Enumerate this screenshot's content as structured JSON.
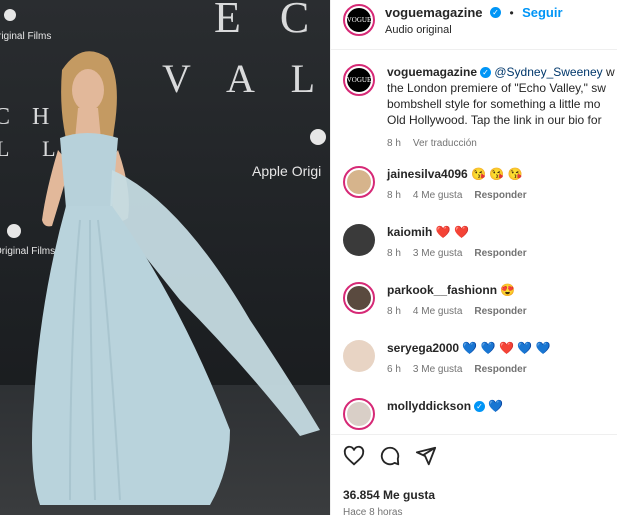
{
  "photo": {
    "bg_text_1": "E C",
    "bg_text_2": "V A L",
    "bg_text_3": "C H O",
    "bg_text_4": "L L",
    "original_films_1": "riginal Films",
    "original_films_2": "Original Films",
    "apple_original": "Apple Origi"
  },
  "header": {
    "avatar_text": "VOGUE",
    "username": "voguemagazine",
    "follow_label": "Seguir",
    "audio": "Audio original"
  },
  "caption": {
    "username": "voguemagazine",
    "mention": "@Sydney_Sweeney",
    "line1_rest": " w",
    "line2": "the London premiere of \"Echo Valley,\" sw",
    "line3": "bombshell style for something a little mo",
    "line4": "Old Hollywood. Tap the link in our bio for",
    "time": "8 h",
    "translate": "Ver traducción"
  },
  "comments": [
    {
      "username": "jainesilva4096",
      "text": "😘 😘 😘",
      "time": "8 h",
      "likes": "4 Me gusta",
      "reply": "Responder",
      "verified": false
    },
    {
      "username": "kaiomih",
      "text": "❤️ ❤️",
      "time": "8 h",
      "likes": "3 Me gusta",
      "reply": "Responder",
      "verified": false
    },
    {
      "username": "parkook__fashionn",
      "text": "😍",
      "time": "8 h",
      "likes": "4 Me gusta",
      "reply": "Responder",
      "verified": false
    },
    {
      "username": "seryega2000",
      "text": "💙 💙 ❤️ 💙 💙",
      "time": "6 h",
      "likes": "3 Me gusta",
      "reply": "Responder",
      "verified": false
    },
    {
      "username": "mollyddickson",
      "text": "💙",
      "time": "",
      "likes": "",
      "reply": "",
      "verified": true
    }
  ],
  "footer": {
    "likes": "36.854 Me gusta",
    "timestamp": "Hace 8 horas"
  },
  "icons": {
    "like": "heart-icon",
    "comment": "comment-icon",
    "share": "share-icon",
    "verified": "verified-badge-icon"
  },
  "colors": {
    "accent": "#0095f6",
    "dress": "#b9d3dc",
    "backdrop": "#1f2225"
  }
}
